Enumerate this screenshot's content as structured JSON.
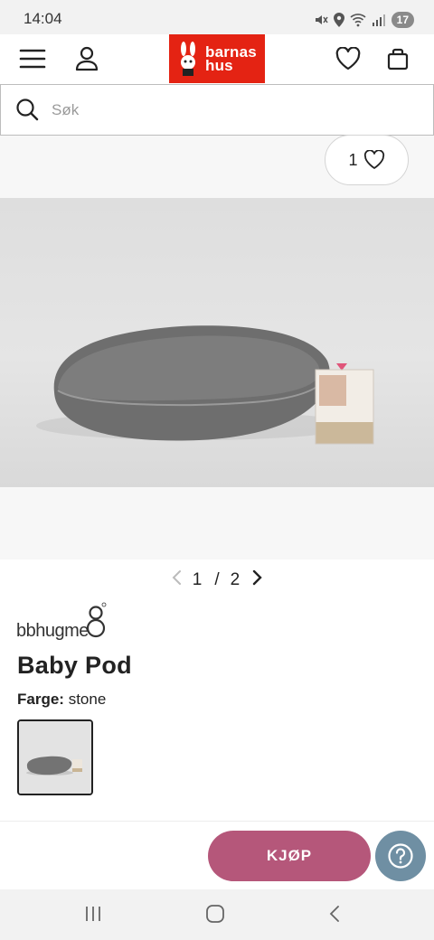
{
  "status_bar": {
    "time": "14:04",
    "battery": "17",
    "icons": [
      "mute-icon",
      "location-icon",
      "wifi-icon",
      "signal-icon",
      "battery-icon"
    ]
  },
  "header": {
    "logo_text_line1": "barnas",
    "logo_text_line2": "hus",
    "brand_color": "#e42313",
    "icons": [
      "menu-icon",
      "user-icon",
      "heart-icon",
      "bag-icon"
    ]
  },
  "search": {
    "placeholder": "Søk"
  },
  "gallery": {
    "wishlist_count": "1",
    "current_page": "1",
    "separator": "/",
    "total_pages": "2"
  },
  "product": {
    "brand": "bbhugme",
    "name": "Baby Pod",
    "color_label": "Farge:",
    "color_value": "stone"
  },
  "actions": {
    "buy_label": "KJØP",
    "buy_color": "#b5577a",
    "help_color": "#6f8fa3"
  },
  "navbar": {
    "icons": [
      "recent-apps-icon",
      "home-icon",
      "back-icon"
    ]
  }
}
